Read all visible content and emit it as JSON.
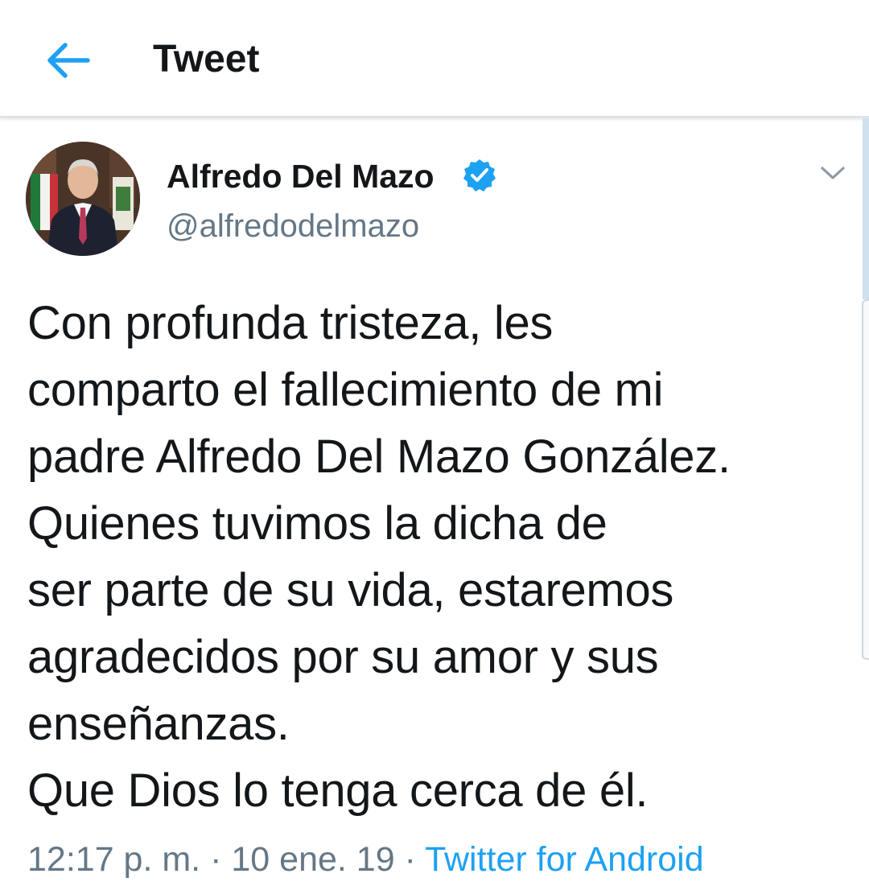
{
  "header": {
    "title": "Tweet",
    "back_icon": "back-arrow-icon"
  },
  "author": {
    "display_name": "Alfredo Del Mazo",
    "handle": "@alfredodelmazo",
    "verified": true
  },
  "tweet": {
    "lines": [
      "Con profunda tristeza, les",
      "comparto el fallecimiento de mi",
      "padre Alfredo Del Mazo González.",
      "Quienes tuvimos la dicha de",
      "ser parte de su vida, estaremos",
      "agradecidos por su amor y sus",
      "enseñanzas.",
      "Que Dios lo tenga cerca de él."
    ],
    "time": "12:17 p. m.",
    "separator": "·",
    "date": "10 ene. 19",
    "source": "Twitter for Android"
  },
  "colors": {
    "accent": "#1da1f2",
    "text": "#14171a",
    "muted": "#657786"
  }
}
